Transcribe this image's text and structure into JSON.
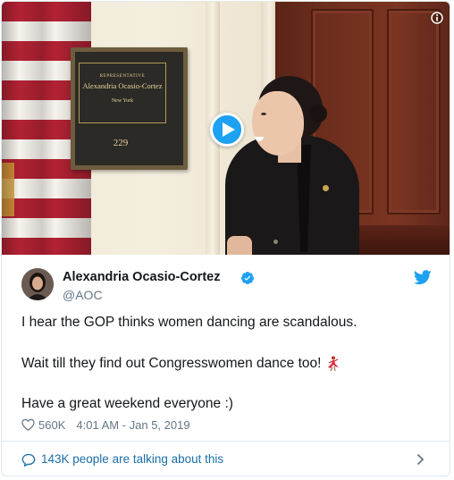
{
  "media": {
    "plaque": {
      "title": "REPRESENTATIVE",
      "name": "Alexandria Ocasio-Cortez",
      "state": "New York",
      "room": "229"
    }
  },
  "tweet": {
    "author_name": "Alexandria Ocasio-Cortez",
    "handle": "@AOC",
    "lines": [
      "I hear the GOP thinks women dancing are scandalous.",
      "Wait till they find out Congresswomen dance too!",
      "Have a great weekend everyone :)"
    ],
    "likes": "560K",
    "timestamp": "4:01 AM - Jan 5, 2019"
  },
  "footer": {
    "talking": "143K people are talking about this"
  },
  "colors": {
    "accent": "#1da1f2",
    "link": "#1b6ea8",
    "muted": "#657786",
    "text": "#14171a",
    "border": "#e1e8ed"
  },
  "icons": [
    "play-icon",
    "info-icon",
    "verified-icon",
    "twitter-bird-icon",
    "dancer-emoji-icon",
    "heart-icon",
    "speech-bubble-icon",
    "chevron-right-icon"
  ]
}
